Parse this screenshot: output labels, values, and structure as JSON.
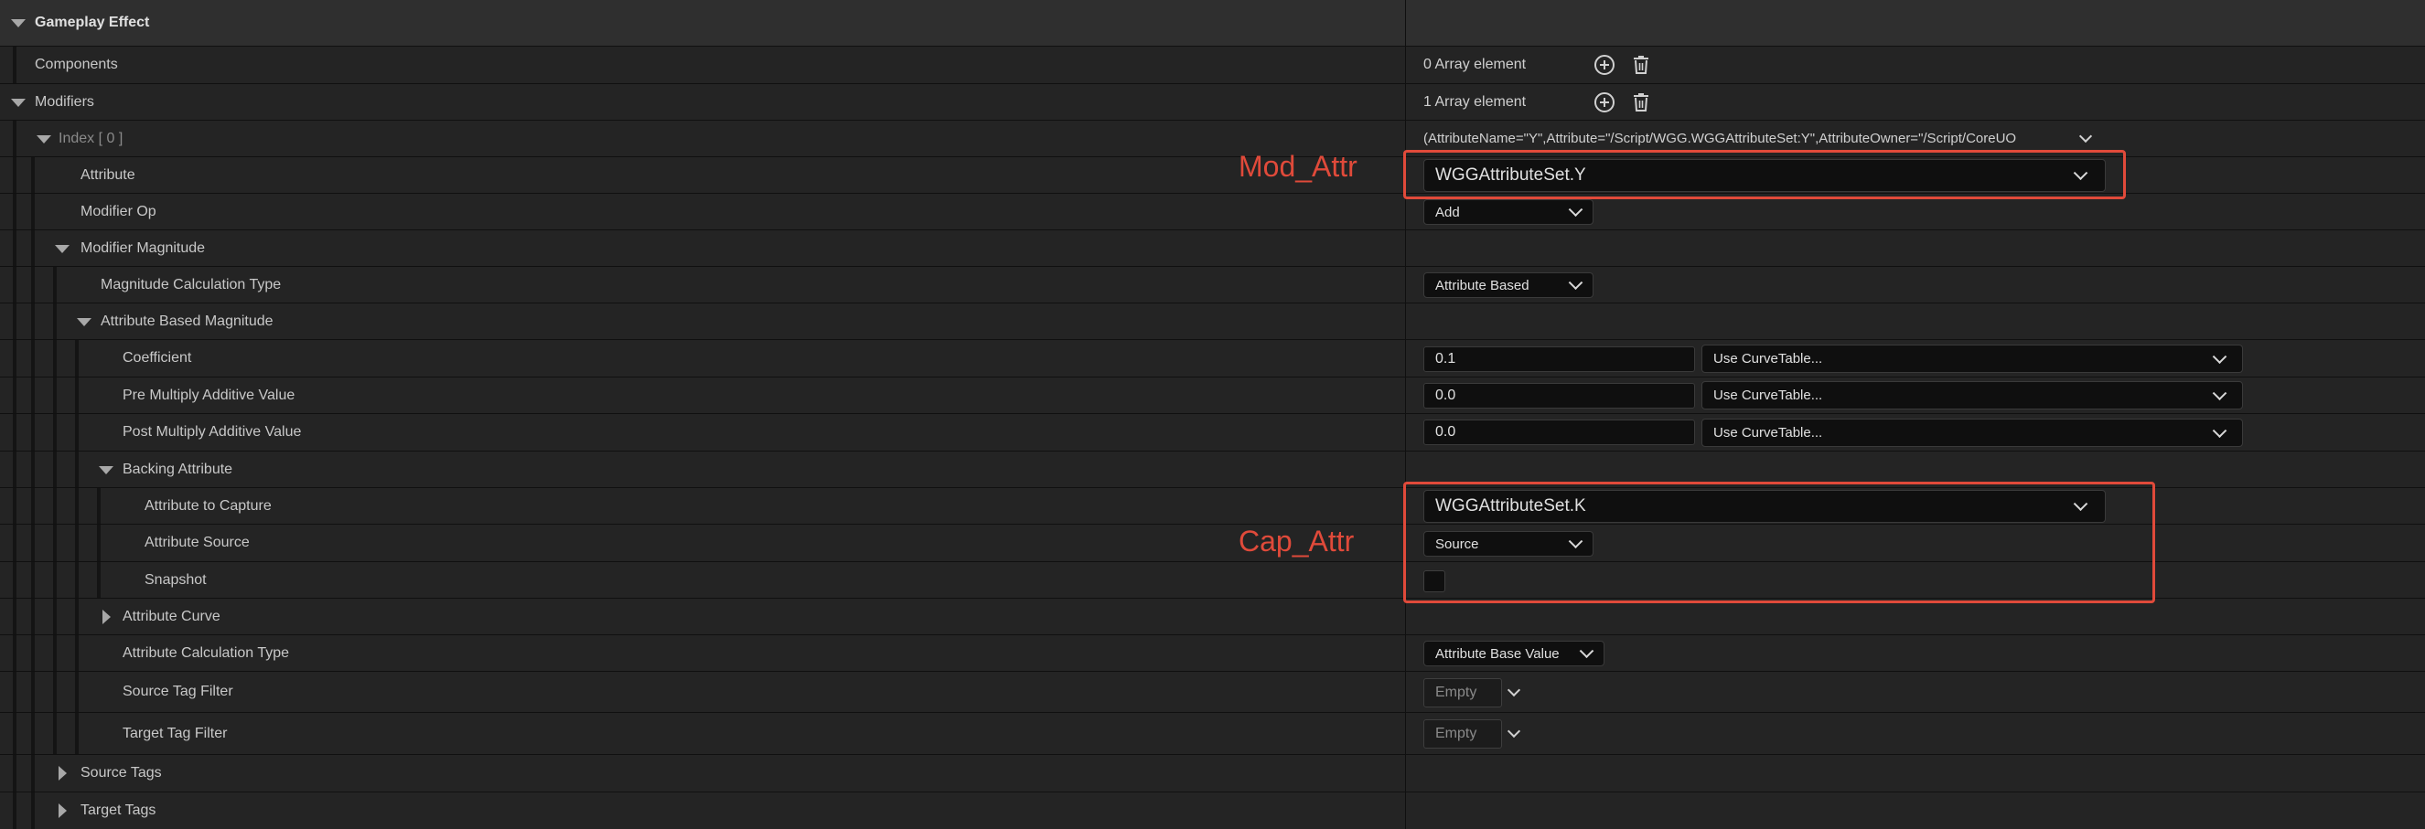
{
  "rows": {
    "gameplay_effect": {
      "label": "Gameplay Effect"
    },
    "components": {
      "label": "Components",
      "value": "0 Array element"
    },
    "modifiers": {
      "label": "Modifiers",
      "value": "1 Array element"
    },
    "index0": {
      "label": "Index [ 0 ]",
      "value": "(AttributeName=\"Y\",Attribute=\"/Script/WGG.WGGAttributeSet:Y\",AttributeOwner=\"/Script/CoreUO"
    },
    "attribute": {
      "label": "Attribute",
      "value": "WGGAttributeSet.Y"
    },
    "modifier_op": {
      "label": "Modifier Op",
      "value": "Add"
    },
    "modifier_magnitude": {
      "label": "Modifier Magnitude"
    },
    "mag_calc_type": {
      "label": "Magnitude Calculation Type",
      "value": "Attribute Based"
    },
    "attr_based_mag": {
      "label": "Attribute Based Magnitude"
    },
    "coefficient": {
      "label": "Coefficient",
      "value": "0.1",
      "curve": "Use CurveTable..."
    },
    "pre_mult": {
      "label": "Pre Multiply Additive Value",
      "value": "0.0",
      "curve": "Use CurveTable..."
    },
    "post_mult": {
      "label": "Post Multiply Additive Value",
      "value": "0.0",
      "curve": "Use CurveTable..."
    },
    "backing_attribute": {
      "label": "Backing Attribute"
    },
    "attr_to_capture": {
      "label": "Attribute to Capture",
      "value": "WGGAttributeSet.K"
    },
    "attr_source": {
      "label": "Attribute Source",
      "value": "Source"
    },
    "snapshot": {
      "label": "Snapshot",
      "checked": false
    },
    "attribute_curve": {
      "label": "Attribute Curve"
    },
    "attr_calc_type": {
      "label": "Attribute Calculation Type",
      "value": "Attribute Base Value"
    },
    "source_tag_filter": {
      "label": "Source Tag Filter",
      "value": "Empty"
    },
    "target_tag_filter": {
      "label": "Target Tag Filter",
      "value": "Empty"
    },
    "source_tags": {
      "label": "Source Tags"
    },
    "target_tags": {
      "label": "Target Tags"
    }
  },
  "annotations": {
    "mod_attr": "Mod_Attr",
    "cap_attr": "Cap_Attr"
  },
  "icons": {
    "add": "plus-circle-icon",
    "delete": "trash-icon"
  },
  "colors": {
    "annotation": "#e04a3a",
    "background": "#242424",
    "category": "#2f2f2f"
  }
}
